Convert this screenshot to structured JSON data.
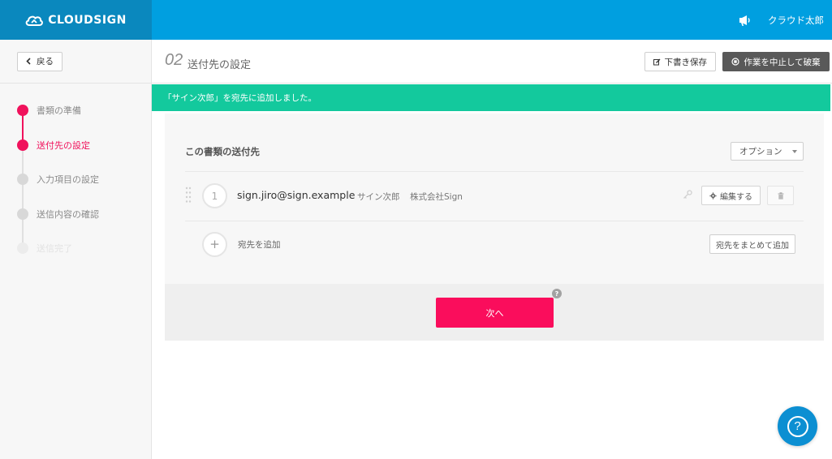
{
  "brand": {
    "logo_text": "CLOUDSIGN",
    "header_color": "#009fe0",
    "logo_bg": "#0a88be"
  },
  "header": {
    "user_name": "クラウド太郎",
    "announce_icon": "megaphone-icon"
  },
  "sidebar": {
    "back_label": "戻る",
    "steps": [
      {
        "label": "書類の準備",
        "state": "done"
      },
      {
        "label": "送付先の設定",
        "state": "active"
      },
      {
        "label": "入力項目の設定",
        "state": "todo"
      },
      {
        "label": "送信内容の確認",
        "state": "todo"
      },
      {
        "label": "送信完了",
        "state": "faded"
      }
    ]
  },
  "main": {
    "step_number": "02",
    "title": "送付先の設定",
    "draft_label": "下書き保存",
    "abort_label": "作業を中止して破棄"
  },
  "notice": {
    "text": "「サイン次郎」を宛先に追加しました。",
    "color": "#13c99d"
  },
  "recipients": {
    "section_title": "この書類の送付先",
    "option_label": "オプション",
    "rows": [
      {
        "order": "1",
        "email": "sign.jiro@sign.example",
        "name": "サイン次郎",
        "company": "株式会社Sign",
        "edit_label": "編集する"
      }
    ],
    "add_label": "宛先を追加",
    "bulk_add_label": "宛先をまとめて追加",
    "add_symbol": "+"
  },
  "footer": {
    "next_label": "次へ",
    "help_symbol": "?"
  },
  "help": {
    "symbol": "?"
  },
  "accent": "#f0125c"
}
